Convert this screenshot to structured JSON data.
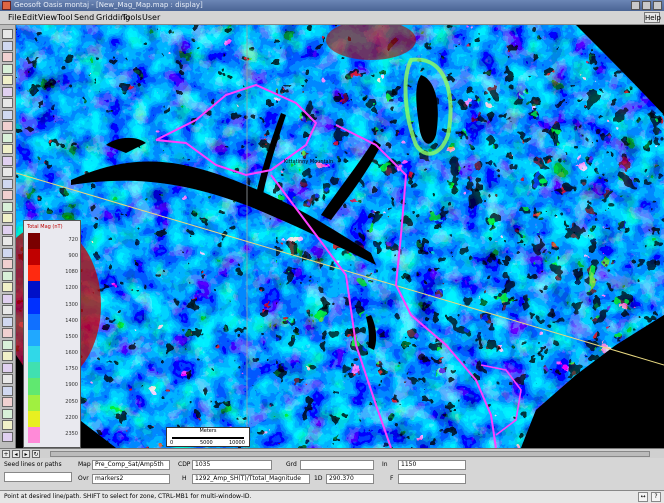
{
  "window": {
    "title": "Geosoft Oasis montaj - [New_Mag_Map.map : display]"
  },
  "menu": {
    "items": [
      "File",
      "Edit",
      "View",
      "Tool",
      "Send",
      "Gridding",
      "Tools",
      "User"
    ],
    "help": "Help"
  },
  "map": {
    "place_label": "Kittatinny Mountain",
    "legend": {
      "title": "Total Mag (nT)",
      "labels": [
        "720",
        "900",
        "1080",
        "1200",
        "1300",
        "1400",
        "1500",
        "1600",
        "1750",
        "1900",
        "2050",
        "2200",
        "2350"
      ],
      "colors": [
        "#7a0000",
        "#c00000",
        "#ff2a10",
        "#0010c8",
        "#0030ff",
        "#1070ff",
        "#20a8ff",
        "#30d8e8",
        "#40e0b0",
        "#60e870",
        "#a0f040",
        "#e8f020",
        "#ff8ad8"
      ]
    },
    "scalebar": {
      "title": "Meters",
      "ticks": [
        "0",
        "5000",
        "10000"
      ]
    }
  },
  "info": {
    "line_label": "Seed lines or paths",
    "map_label": "Map",
    "map_value": "Pre_Comp_Sat/Amp5th",
    "ovr_label": "Ovr",
    "ovr_value": "markers2",
    "cdp_label": "CDP",
    "cdp_value": "1035",
    "h_label": "H",
    "h_value": "1292_Amp_SH(T)/Ttotal_Magnitude",
    "grd_label": "Grd",
    "z_label": "1D",
    "z_value": "290.370",
    "in_label": "In",
    "in_value": "1150",
    "f_label": "F"
  },
  "status": {
    "text": "Point at desired line/path. SHIFT to select for zone, CTRL-MB1 for multi-window-ID."
  },
  "colors": {
    "titlebar": "#5670a3",
    "panel": "#c0c0c0",
    "path": "#e040e0",
    "ocean": "#000000"
  }
}
